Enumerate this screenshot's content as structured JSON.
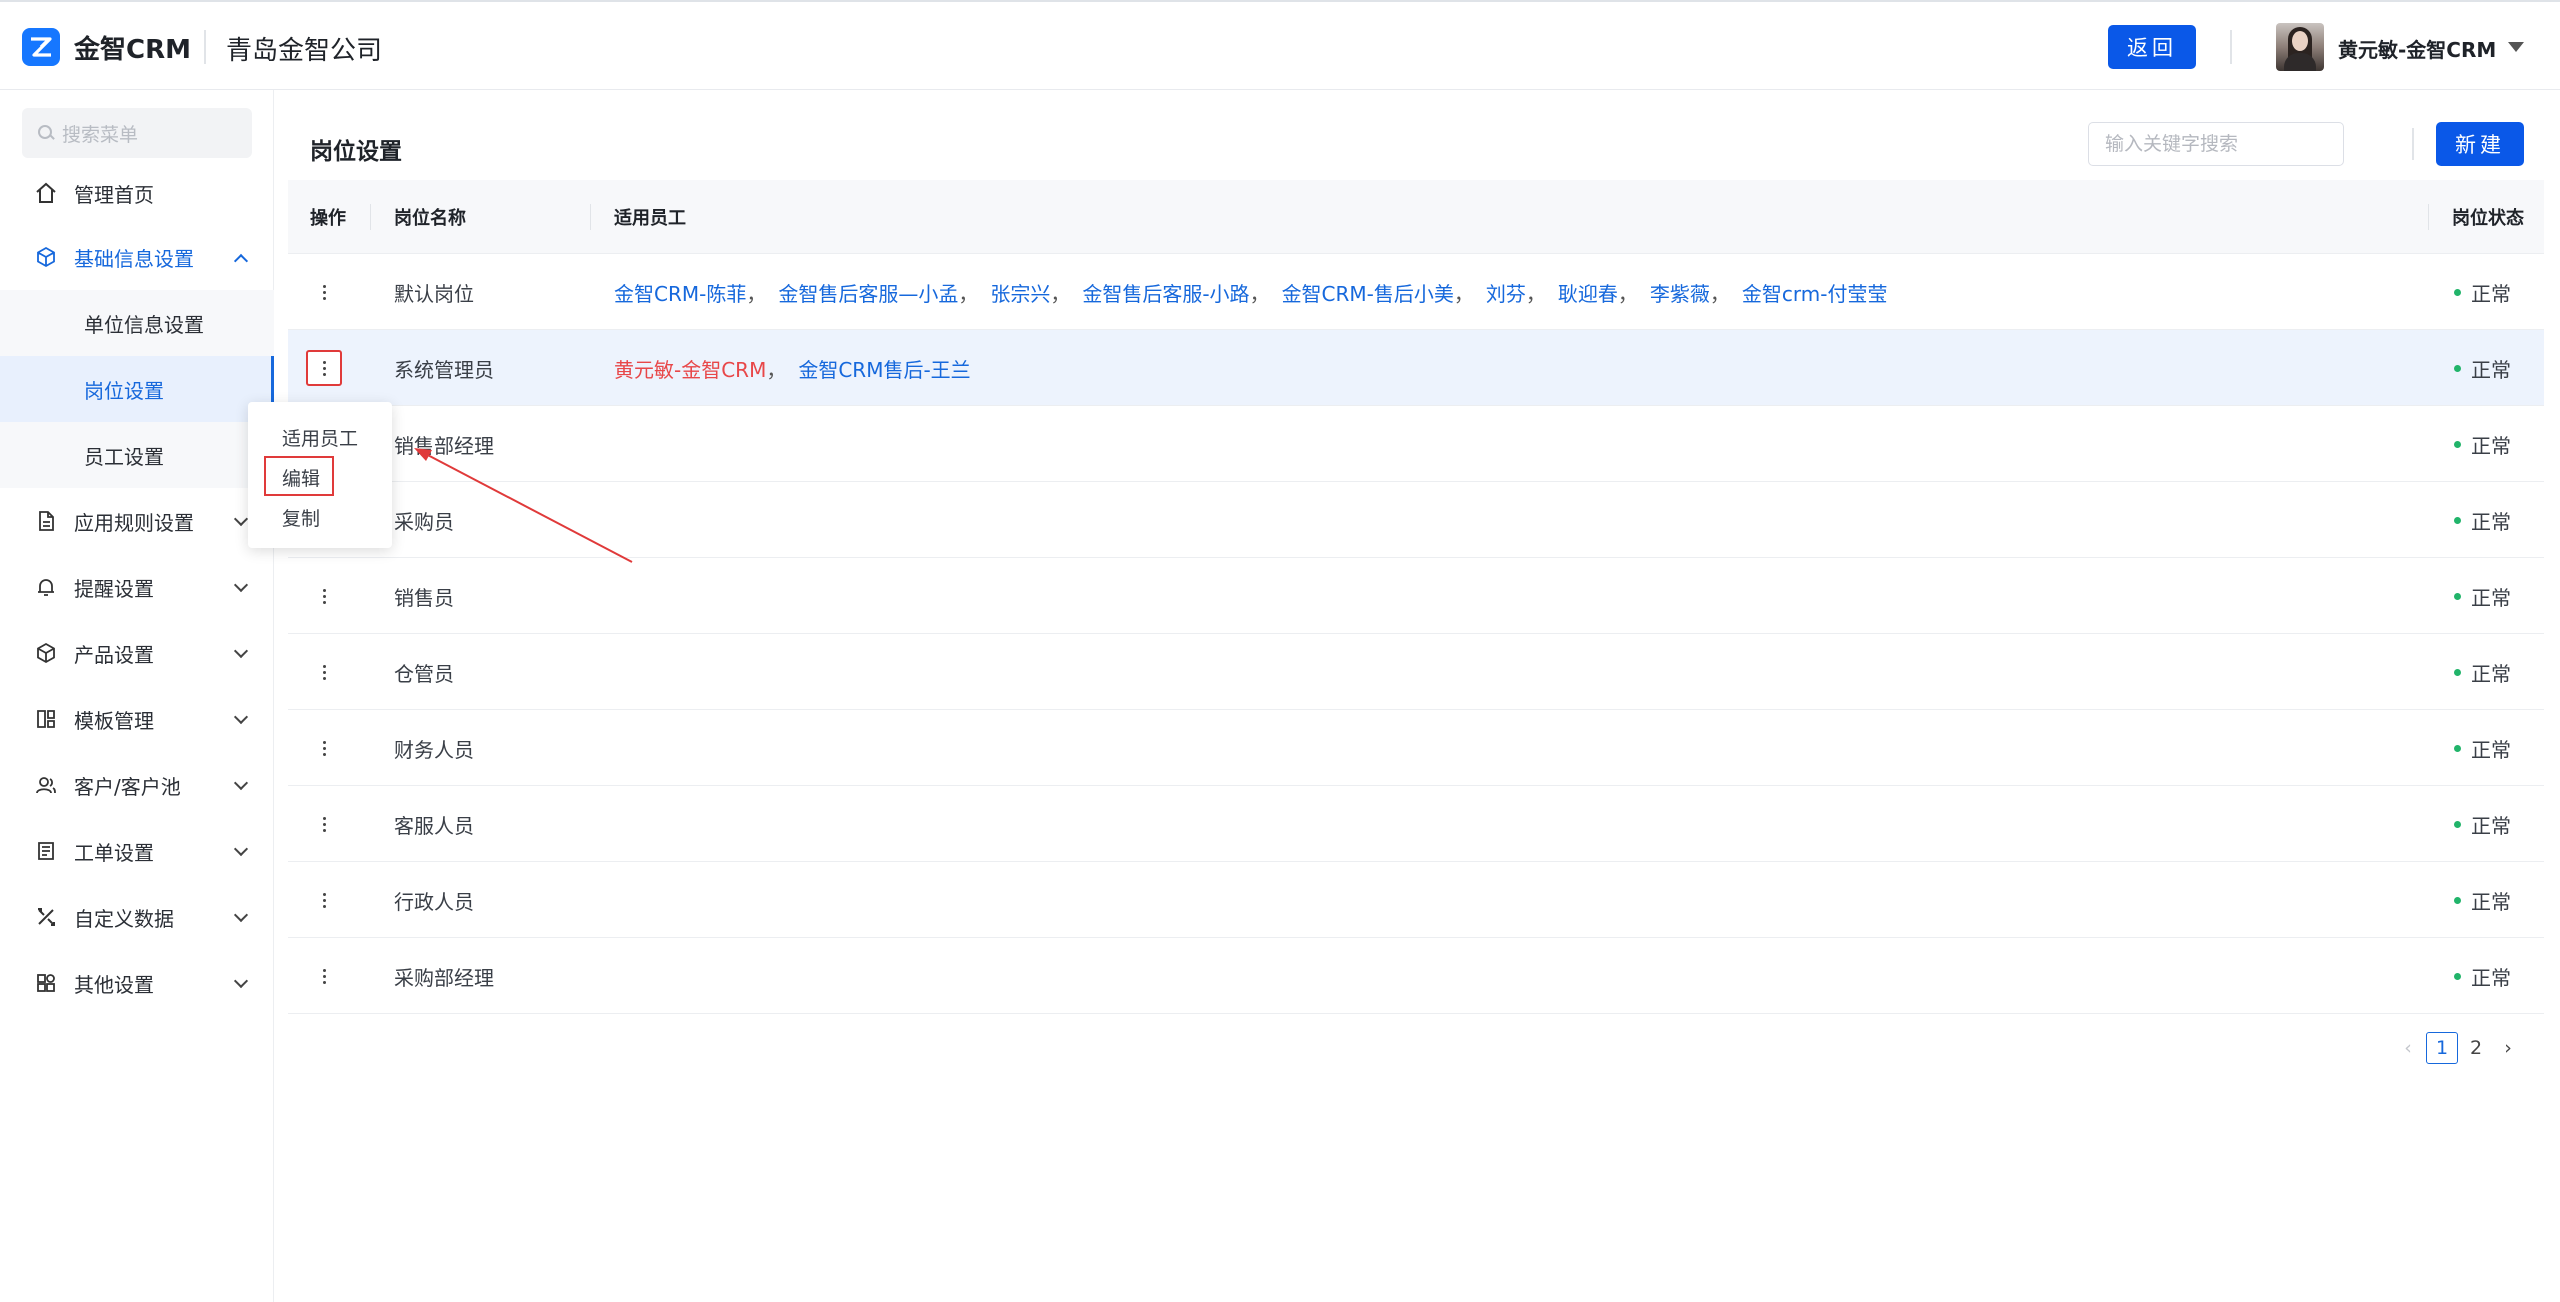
{
  "header": {
    "logo_text": "金智CRM",
    "company": "青岛金智公司",
    "back_label": "返回",
    "user_name": "黄元敏-金智CRM"
  },
  "sidebar": {
    "search_placeholder": "搜索菜单",
    "items": [
      {
        "label": "管理首页",
        "icon": "home-icon"
      },
      {
        "label": "基础信息设置",
        "icon": "cube-icon",
        "expanded": true
      },
      {
        "label": "应用规则设置",
        "icon": "document-icon"
      },
      {
        "label": "提醒设置",
        "icon": "bell-icon"
      },
      {
        "label": "产品设置",
        "icon": "cube-icon"
      },
      {
        "label": "模板管理",
        "icon": "template-icon"
      },
      {
        "label": "客户/客户池",
        "icon": "customer-icon"
      },
      {
        "label": "工单设置",
        "icon": "ticket-icon"
      },
      {
        "label": "自定义数据",
        "icon": "tools-icon"
      },
      {
        "label": "其他设置",
        "icon": "apps-icon"
      }
    ],
    "sub_items": [
      {
        "label": "单位信息设置"
      },
      {
        "label": "岗位设置",
        "active": true
      },
      {
        "label": "员工设置"
      }
    ]
  },
  "main": {
    "title": "岗位设置",
    "search_placeholder": "输入关键字搜索",
    "new_label": "新建",
    "columns": {
      "op": "操作",
      "name": "岗位名称",
      "employees": "适用员工",
      "status": "岗位状态"
    },
    "rows": [
      {
        "name": "默认岗位",
        "employees": [
          "金智CRM-陈菲",
          "金智售后客服—小孟",
          "张宗兴",
          "金智售后客服-小路",
          "金智CRM-售后小美",
          "刘芬",
          "耿迎春",
          "李紫薇",
          "金智crm-付莹莹"
        ],
        "status": "正常"
      },
      {
        "name": "系统管理员",
        "employees": [
          "黄元敏-金智CRM",
          "金智CRM售后-王兰"
        ],
        "status": "正常",
        "highlighted": true
      },
      {
        "name": "销售部经理",
        "employees": [],
        "status": "正常"
      },
      {
        "name": "采购员",
        "employees": [],
        "status": "正常"
      },
      {
        "name": "销售员",
        "employees": [],
        "status": "正常"
      },
      {
        "name": "仓管员",
        "employees": [],
        "status": "正常"
      },
      {
        "name": "财务人员",
        "employees": [],
        "status": "正常"
      },
      {
        "name": "客服人员",
        "employees": [],
        "status": "正常"
      },
      {
        "name": "行政人员",
        "employees": [],
        "status": "正常"
      },
      {
        "name": "采购部经理",
        "employees": [],
        "status": "正常"
      }
    ],
    "separator": "，",
    "dropdown": [
      "适用员工",
      "编辑",
      "复制"
    ],
    "pagination": {
      "pages": [
        "1",
        "2"
      ],
      "current": "1",
      "prev": "‹",
      "next": "›"
    }
  },
  "colors": {
    "primary": "#0a58e8",
    "link": "#1668dc",
    "highlight_text": "#e84749",
    "status_ok": "#21b46a",
    "annotation": "#e03a3a"
  }
}
